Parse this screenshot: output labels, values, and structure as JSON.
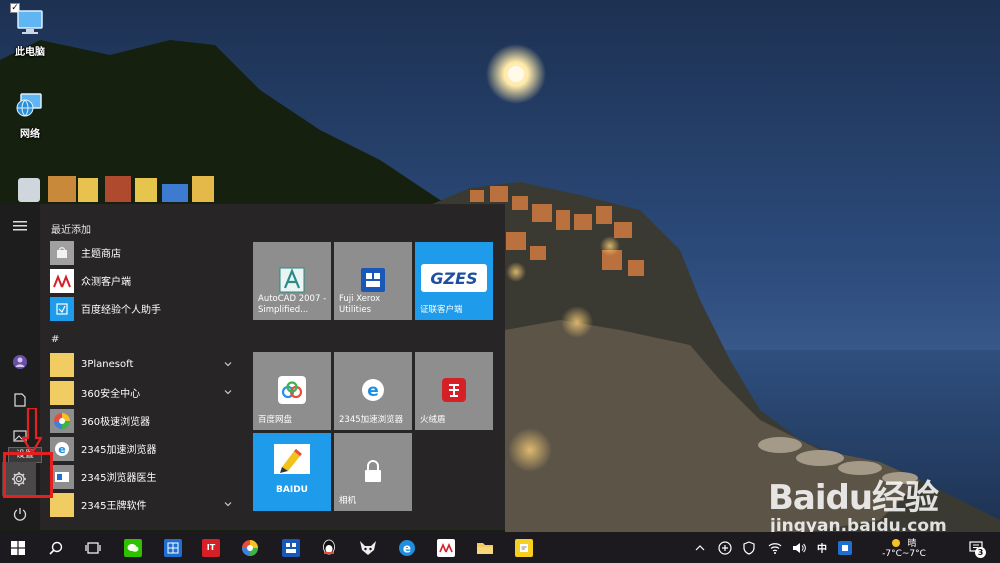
{
  "desktop": {
    "icons": [
      {
        "label": "此电脑"
      },
      {
        "label": "网络"
      }
    ]
  },
  "start_menu": {
    "recent_header": "最近添加",
    "recent_apps": [
      {
        "label": "主题商店",
        "icon": "store-icon"
      },
      {
        "label": "众测客户端",
        "icon": "zhongce-icon"
      },
      {
        "label": "百度经验个人助手",
        "icon": "baidu-jingyan-icon"
      }
    ],
    "hash_header": "#",
    "apps": [
      {
        "label": "3Planesoft",
        "icon": "folder-icon",
        "expandable": true
      },
      {
        "label": "360安全中心",
        "icon": "folder-icon",
        "expandable": true
      },
      {
        "label": "360极速浏览器",
        "icon": "360-browser-icon",
        "expandable": false
      },
      {
        "label": "2345加速浏览器",
        "icon": "ie-like-icon",
        "expandable": false
      },
      {
        "label": "2345浏览器医生",
        "icon": "doctor-icon",
        "expandable": false
      },
      {
        "label": "2345王牌软件",
        "icon": "folder-icon",
        "expandable": true
      }
    ],
    "rail_tooltip": "设置",
    "tiles_group1": [
      {
        "label": "AutoCAD 2007 - Simplified...",
        "icon": "autocad-icon"
      },
      {
        "label": "Fuji Xerox Utilities",
        "icon": "fuji-xerox-icon"
      },
      {
        "label": "证联客户端",
        "icon": "gzes-icon",
        "logo_text": "GZES"
      }
    ],
    "tiles_group2": [
      {
        "label": "百度网盘",
        "icon": "baidu-netdisk-icon"
      },
      {
        "label": "2345加速浏览器",
        "icon": "2345-browser-icon"
      },
      {
        "label": "火绒盾",
        "icon": "huorong-icon"
      },
      {
        "label": "",
        "icon": "baidu-ime-icon",
        "logo_text": "BAIDU"
      },
      {
        "label": "相机",
        "icon": "camera-lock-icon"
      }
    ]
  },
  "taskbar": {
    "ime_label": "中",
    "weather_label": "晴",
    "temperature": "-7°C~7°C",
    "notification_count": "3"
  },
  "watermark": {
    "logo": "Baidu经验",
    "url": "jingyan.baidu.com"
  },
  "colors": {
    "start_bg": "#282526",
    "tile_gray": "#8e8e8e",
    "tile_blue": "#1e9bea",
    "taskbar_bg": "#1c1a1e",
    "annotation_red": "#e52020"
  }
}
